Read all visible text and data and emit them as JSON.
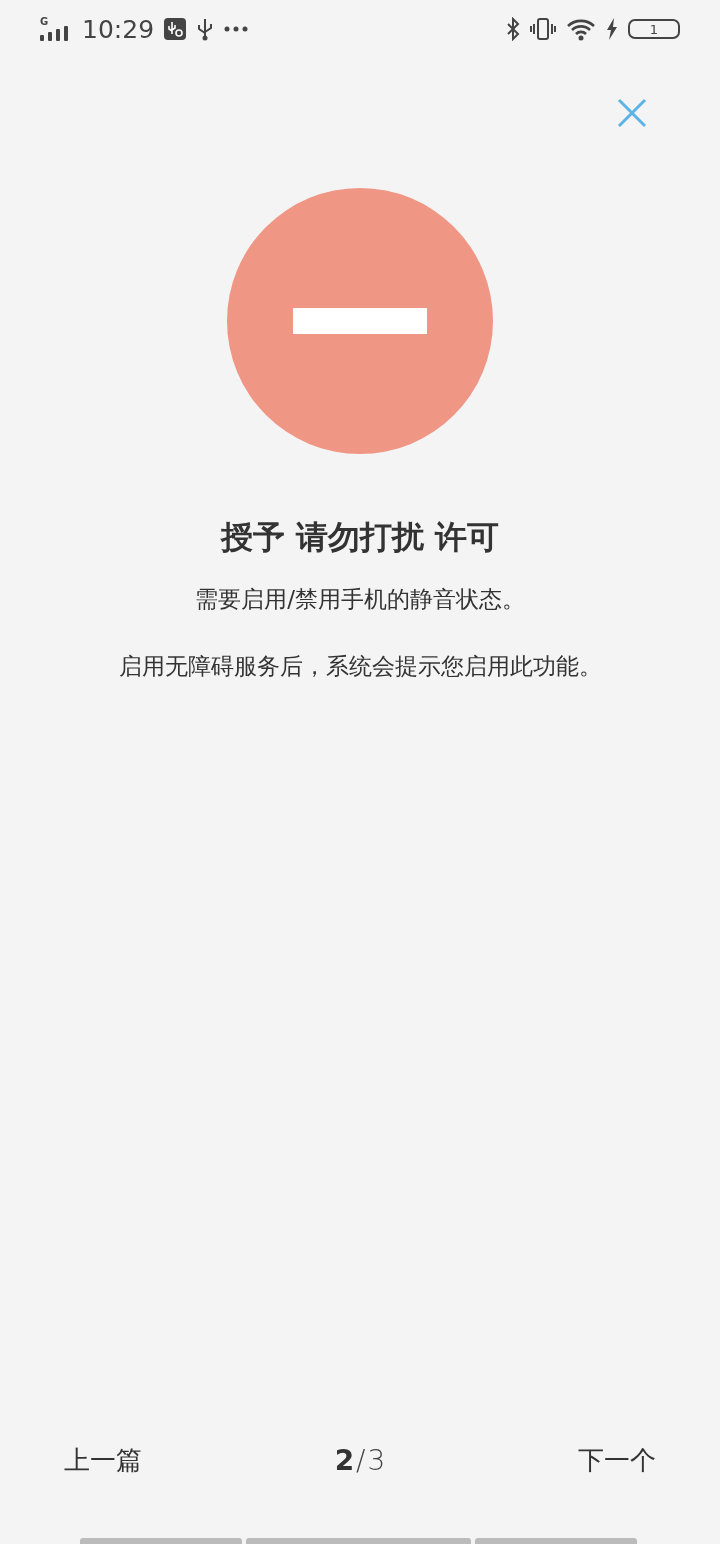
{
  "status_bar": {
    "network": "G",
    "time": "10:29",
    "battery": "1"
  },
  "dialog": {
    "title": "授予 请勿打扰 许可",
    "paragraphs": [
      "需要启用/禁用手机的静音状态。",
      "启用无障碍服务后，系统会提示您启用此功能。"
    ]
  },
  "pager": {
    "previous": "上一篇",
    "current": "2",
    "separator": "/",
    "total": "3",
    "next": "下一个"
  }
}
